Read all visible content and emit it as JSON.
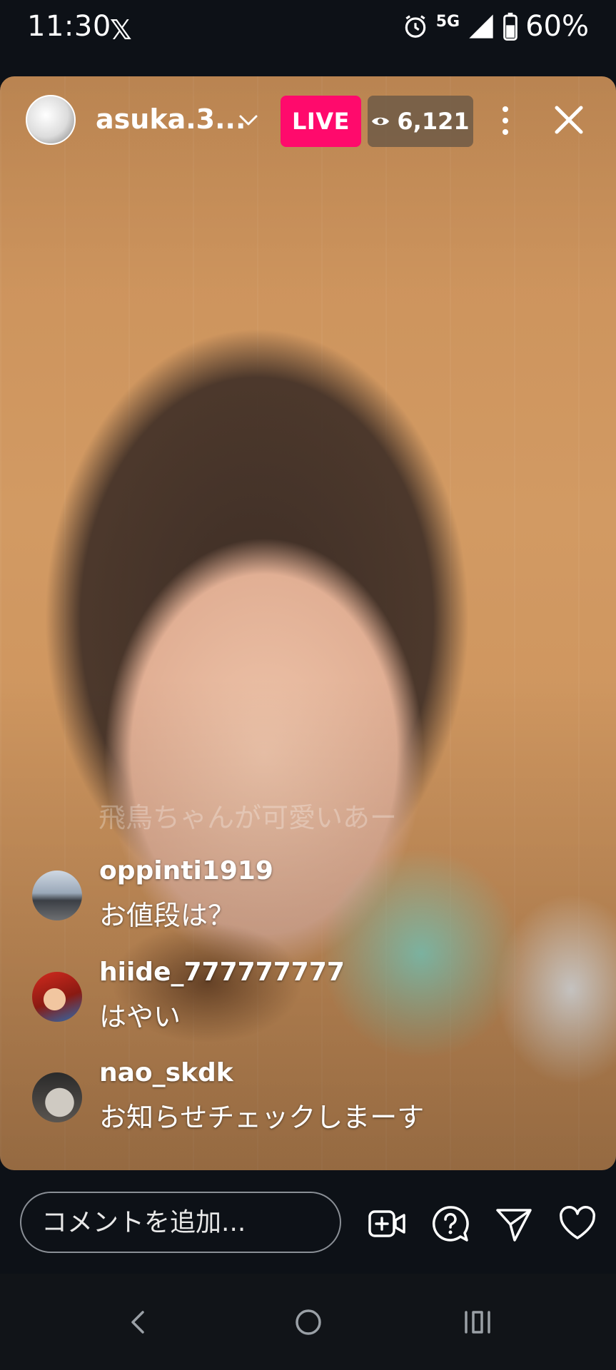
{
  "status_bar": {
    "time": "11:30",
    "network": "5G",
    "battery": "60%"
  },
  "live": {
    "username": "asuka.3...",
    "badge": "LIVE",
    "viewer_count": "6,121",
    "accent_color": "#ff0a6c"
  },
  "comments": {
    "faded": "飛鳥ちゃんが可愛いあー",
    "items": [
      {
        "user": "oppinti1919",
        "text": "お値段は？"
      },
      {
        "user": "hiide_777777777",
        "text": "はやい"
      },
      {
        "user": "nao_skdk",
        "text": "お知らせチェックしまーす"
      }
    ]
  },
  "composer": {
    "placeholder": "コメントを追加..."
  },
  "icons": {
    "actions": [
      "add-video-icon",
      "question-icon",
      "send-icon",
      "heart-icon"
    ],
    "nav": [
      "back-icon",
      "home-icon",
      "recents-icon"
    ]
  }
}
